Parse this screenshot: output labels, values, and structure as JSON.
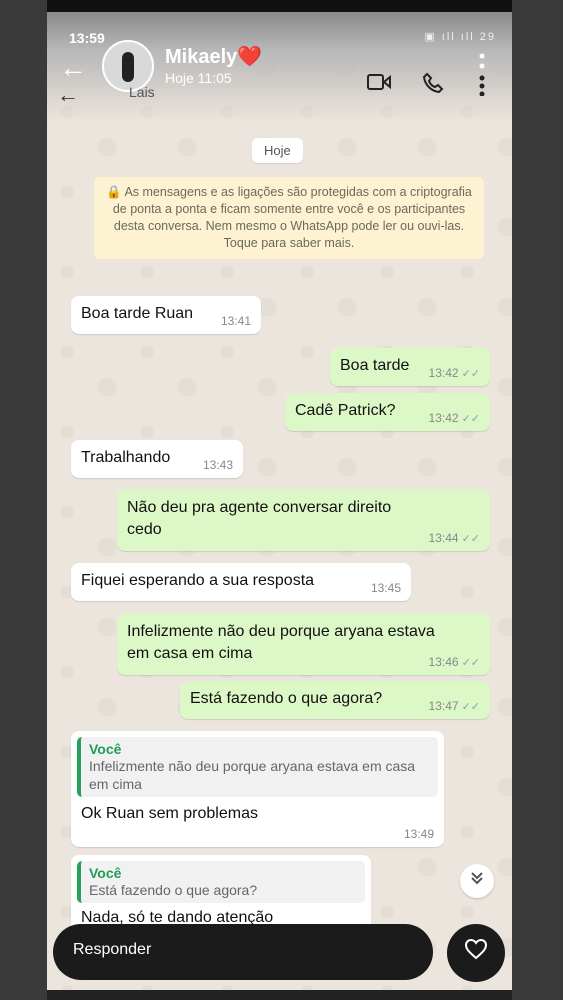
{
  "status": {
    "time": "13:59",
    "icons": "▣ ıll ıll 29"
  },
  "header": {
    "back_icon": "←",
    "name": "Mikaely❤️",
    "subtitle": "Hoje 11:05",
    "behind_name": "Lais"
  },
  "date_chip": "Hoje",
  "notice": "🔒 As mensagens e as ligações são protegidas com a criptografia de ponta a ponta e ficam somente entre você e os participantes desta conversa. Nem mesmo o WhatsApp pode ler ou ouvi-las. Toque para saber mais.",
  "messages": [
    {
      "text": "Boa tarde Ruan",
      "time": "13:41"
    },
    {
      "text": "Boa tarde",
      "time": "13:42"
    },
    {
      "text": "Cadê Patrick?",
      "time": "13:42"
    },
    {
      "text": "Trabalhando",
      "time": "13:43"
    },
    {
      "text": "Não deu pra agente conversar direito cedo",
      "time": "13:44"
    },
    {
      "text": "Fiquei esperando a sua resposta",
      "time": "13:45"
    },
    {
      "text": "Infelizmente não deu porque aryana estava em casa em cima",
      "time": "13:46"
    },
    {
      "text": "Está fazendo o que agora?",
      "time": "13:47"
    },
    {
      "quote_author": "Você",
      "quote_text": "Infelizmente não deu porque aryana estava em casa em cima",
      "text": "Ok Ruan sem problemas",
      "time": "13:49"
    },
    {
      "quote_author": "Você",
      "quote_text": "Está fazendo o que agora?",
      "text": "Nada, só te dando atenção"
    }
  ],
  "ticks": "✓✓",
  "reply": {
    "placeholder": "Responder"
  }
}
